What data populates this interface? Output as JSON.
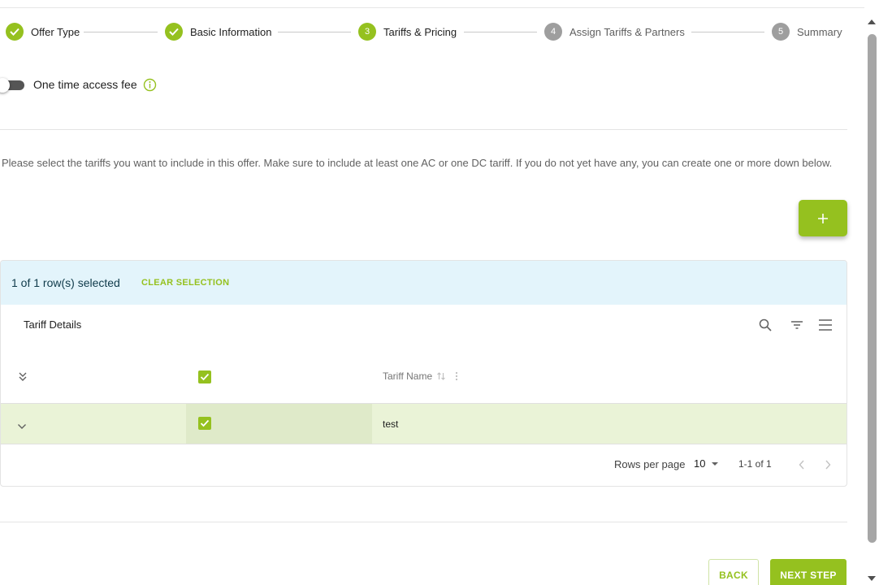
{
  "stepper": {
    "steps": [
      {
        "label": "Offer Type",
        "number": "1",
        "state": "done"
      },
      {
        "label": "Basic Information",
        "number": "2",
        "state": "done"
      },
      {
        "label": "Tariffs & Pricing",
        "number": "3",
        "state": "active"
      },
      {
        "label": "Assign Tariffs & Partners",
        "number": "4",
        "state": "todo"
      },
      {
        "label": "Summary",
        "number": "5",
        "state": "todo"
      }
    ]
  },
  "access_fee": {
    "label": "One time access fee",
    "enabled": false
  },
  "description": "Please select the tariffs you want to include in this offer. Make sure to include at least one AC or one DC tariff. If you do not yet have any, you can create one or more down below.",
  "add_button": {
    "icon": "plus-icon"
  },
  "table": {
    "selection_text": "1 of 1 row(s) selected",
    "clear_label": "CLEAR SELECTION",
    "title": "Tariff Details",
    "toolbar_icons": [
      "search-icon",
      "filter-icon",
      "columns-icon"
    ],
    "column_header": "Tariff Name",
    "rows": [
      {
        "name": "test",
        "selected": true
      }
    ],
    "rows_per_page_label": "Rows per page",
    "rows_per_page": "10",
    "range": "1-1 of 1"
  },
  "actions": {
    "back": "BACK",
    "next": "NEXT STEP"
  },
  "colors": {
    "accent": "#95c11f",
    "selection_bar": "#e3f4fb",
    "selected_row": "#eaf3d7",
    "inactive_step": "#9e9e9e"
  }
}
